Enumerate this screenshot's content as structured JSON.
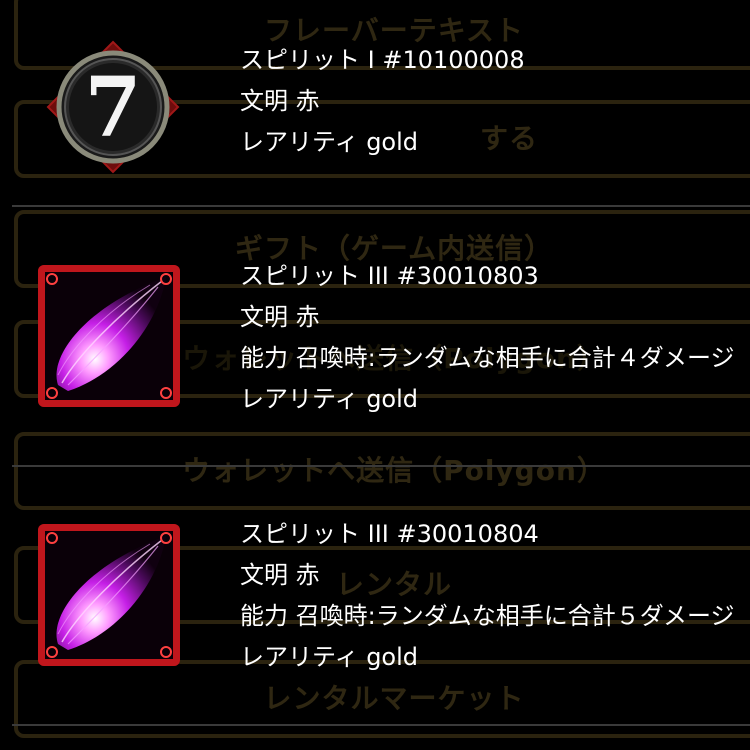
{
  "background_buttons": [
    {
      "label": "フレーバーテキスト"
    },
    {
      "label": "する"
    },
    {
      "label": "ギフト（ゲーム内送信）"
    },
    {
      "label": "ウォレットへ送信（Polygon）"
    },
    {
      "label": "ウォレットへ送信（Polygon）"
    },
    {
      "label": "レンタル"
    },
    {
      "label": "レンタルマーケット"
    }
  ],
  "items": [
    {
      "icon": "number-seven-coin-icon",
      "name": "スピリット I #10100008",
      "civilization": "文明 赤",
      "rarity": "レアリティ gold"
    },
    {
      "icon": "purple-spirit-flame-card-icon",
      "name": "スピリット III #30010803",
      "civilization": "文明 赤",
      "ability": "能力 召喚時:ランダムな相手に合計４ダメージ",
      "rarity": "レアリティ gold"
    },
    {
      "icon": "purple-spirit-flame-card-icon",
      "name": "スピリット III #30010804",
      "civilization": "文明 赤",
      "ability": "能力 召喚時:ランダムな相手に合計５ダメージ",
      "rarity": "レアリティ gold"
    }
  ],
  "colors": {
    "background": "#000000",
    "text": "#ffffff",
    "faded_button_border": "#2b230f",
    "faded_button_text": "#2f2712",
    "card_frame": "#c0161c",
    "flame": "#e040ff",
    "coin_diamond": "#8b1010"
  }
}
